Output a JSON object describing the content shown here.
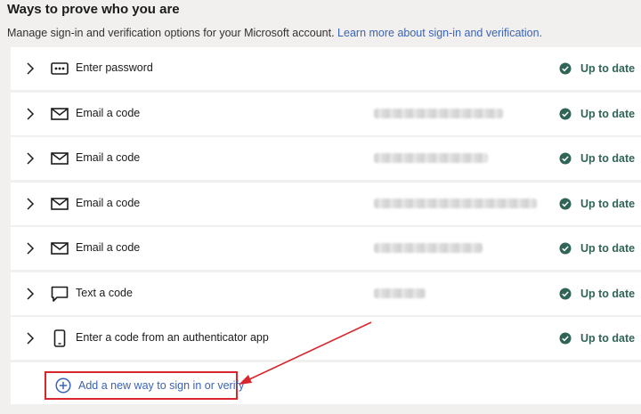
{
  "header": {
    "title": "Ways to prove who you are",
    "subtitle": "Manage sign-in and verification options for your Microsoft account.",
    "learn_more_link": "Learn more about sign-in and verification."
  },
  "methods": [
    {
      "label": "Enter password",
      "icon": "password-dots-icon",
      "detail_blurred": false,
      "status": "Up to date"
    },
    {
      "label": "Email a code",
      "icon": "envelope-icon",
      "detail_blurred": true,
      "status": "Up to date"
    },
    {
      "label": "Email a code",
      "icon": "envelope-icon",
      "detail_blurred": true,
      "status": "Up to date"
    },
    {
      "label": "Email a code",
      "icon": "envelope-icon",
      "detail_blurred": true,
      "status": "Up to date"
    },
    {
      "label": "Email a code",
      "icon": "envelope-icon",
      "detail_blurred": true,
      "status": "Up to date"
    },
    {
      "label": "Text a code",
      "icon": "chat-bubble-icon",
      "detail_blurred": true,
      "status": "Up to date"
    },
    {
      "label": "Enter a code from an authenticator app",
      "icon": "phone-icon",
      "detail_blurred": false,
      "status": "Up to date"
    }
  ],
  "add_method": {
    "label": "Add a new way to sign in or verify",
    "icon": "plus-circle-icon"
  },
  "colors": {
    "status_green": "#2f6457",
    "link_blue": "#3a63b5",
    "highlight_red": "#d9262c"
  }
}
